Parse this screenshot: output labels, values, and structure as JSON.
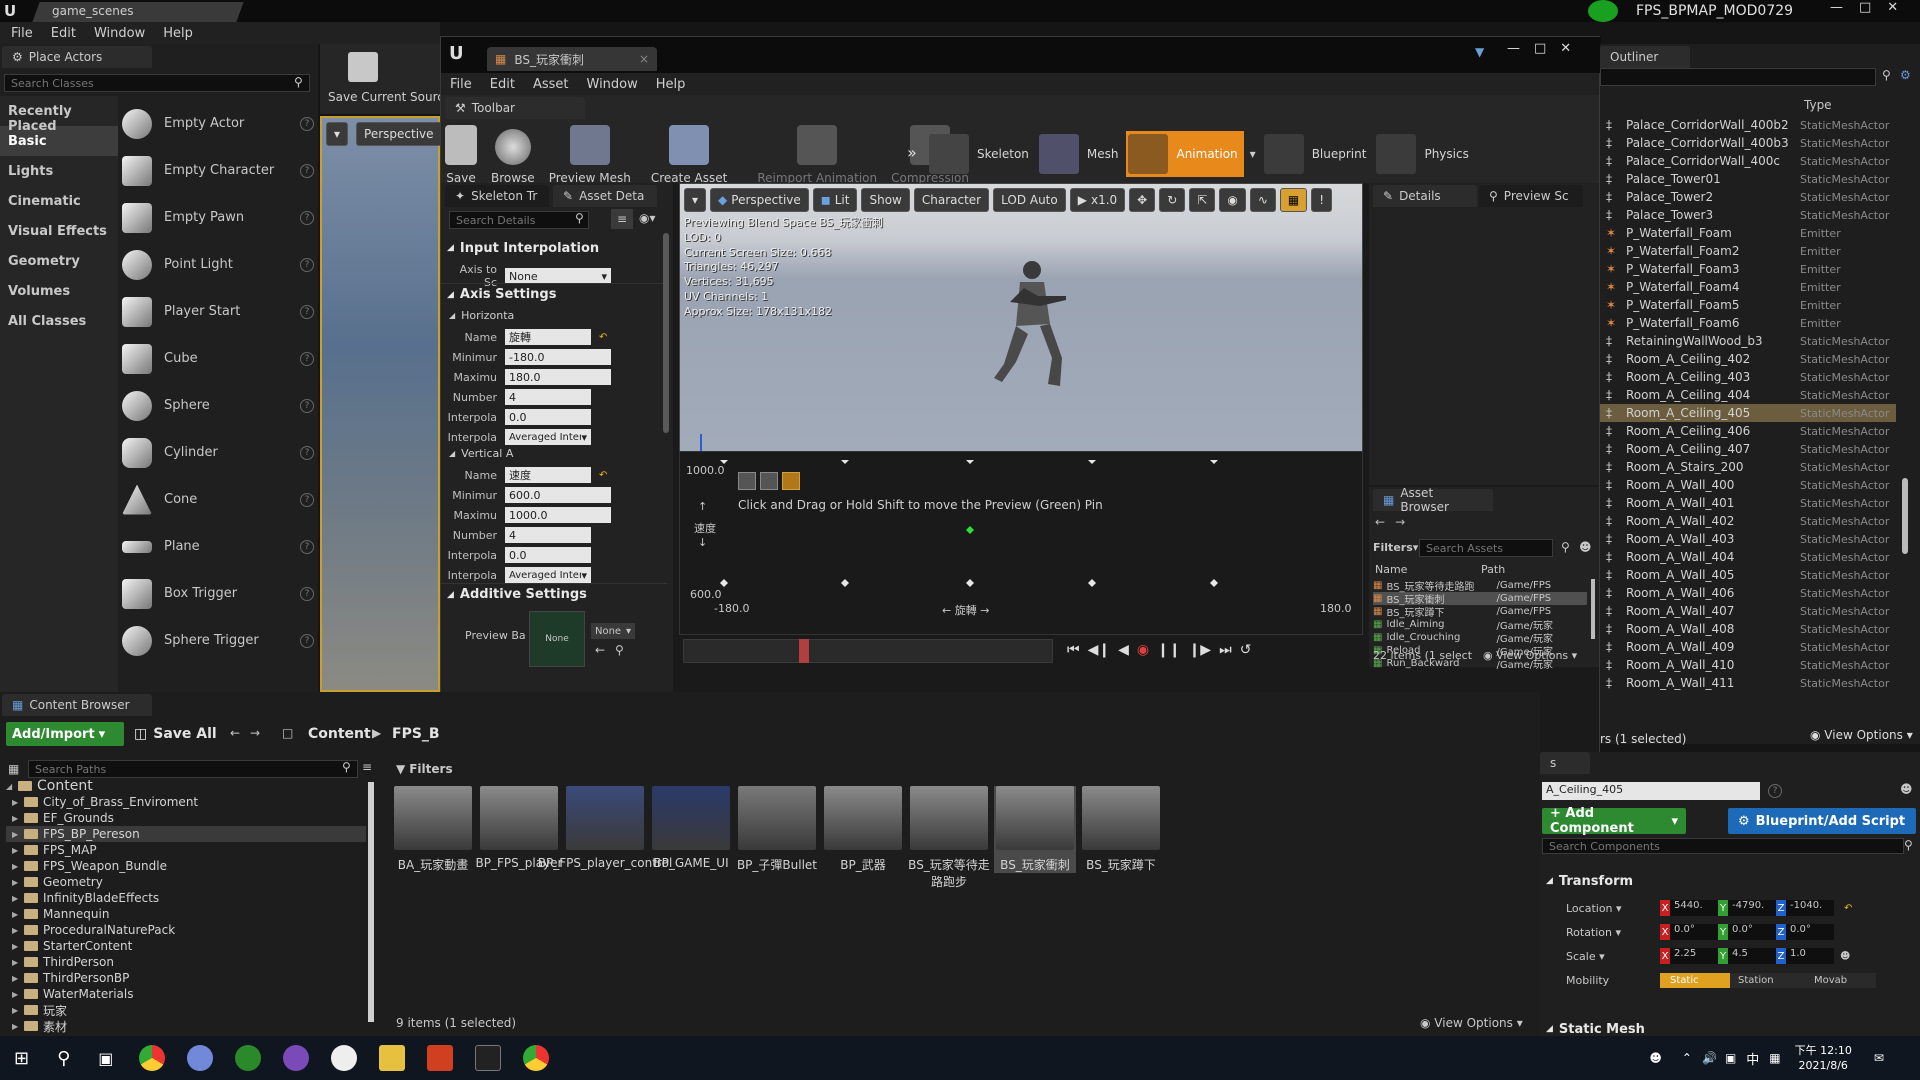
{
  "main_window": {
    "tab": "game_scenes",
    "right_title": "FPS_BPMAP_MOD0729",
    "menu": [
      "File",
      "Edit",
      "Window",
      "Help"
    ]
  },
  "place_actors": {
    "tab": "Place Actors",
    "search_placeholder": "Search Classes",
    "categories": [
      "Recently Placed",
      "Basic",
      "Lights",
      "Cinematic",
      "Visual Effects",
      "Geometry",
      "Volumes",
      "All Classes"
    ],
    "items": [
      "Empty Actor",
      "Empty Character",
      "Empty Pawn",
      "Point Light",
      "Player Start",
      "Cube",
      "Sphere",
      "Cylinder",
      "Cone",
      "Plane",
      "Box Trigger",
      "Sphere Trigger"
    ]
  },
  "main_toolbar": {
    "save_current": "Save Current",
    "source": "Sourc"
  },
  "main_viewport": {
    "perspective": "Perspective"
  },
  "editor": {
    "tab": "BS_玩家衝刺",
    "menu": [
      "File",
      "Edit",
      "Asset",
      "Window",
      "Help"
    ],
    "toolbar_tab": "Toolbar",
    "toolbar": [
      "Save",
      "Browse",
      "Preview Mesh",
      "Create Asset",
      "Reimport Animation",
      "Compression"
    ],
    "modes": [
      "Skeleton",
      "Mesh",
      "Animation",
      "Blueprint",
      "Physics"
    ],
    "left_tabs": [
      "Skeleton Tr",
      "Asset Deta"
    ],
    "search_details": "Search Details",
    "input_interp": {
      "title": "Input Interpolation",
      "axis_label": "Axis to Sc",
      "axis_value": "None"
    },
    "axis_settings": "Axis Settings",
    "horizontal": {
      "title": "Horizonta",
      "name_label": "Name",
      "name": "旋轉",
      "min_label": "Minimur",
      "min": "-180.0",
      "max_label": "Maximu",
      "max": "180.0",
      "num_label": "Number",
      "num": "4",
      "interp_label": "Interpola",
      "interp": "0.0",
      "interp2_label": "Interpola",
      "interp2": "Averaged Interpo"
    },
    "vertical": {
      "title": "Vertical A",
      "name_label": "Name",
      "name": "速度",
      "min_label": "Minimur",
      "min": "600.0",
      "max_label": "Maximu",
      "max": "1000.0",
      "num_label": "Number",
      "num": "4",
      "interp_label": "Interpola",
      "interp": "0.0",
      "interp2_label": "Interpola",
      "interp2": "Averaged Interpo"
    },
    "additive": {
      "title": "Additive Settings",
      "preview_label": "Preview Ba",
      "thumb": "None",
      "select": "None"
    },
    "viewport_buttons": [
      "Perspective",
      "Lit",
      "Show",
      "Character",
      "LOD Auto",
      "x1.0"
    ],
    "preview_info": [
      "Previewing Blend Space BS_玩家衝刺",
      "LOD: 0",
      "Current Screen Size: 0.668",
      "Triangles: 46,297",
      "Vertices: 31,695",
      "UV Channels: 1",
      "Approx Size: 178x131x182"
    ],
    "blend": {
      "y_max": "1000.0",
      "y_min": "600.0",
      "x_min": "-180.0",
      "x_max": "180.0",
      "x_label": "旋轉",
      "y_label": "速度",
      "hint": "Click and Drag or Hold Shift to move the Preview (Green) Pin"
    },
    "right_tabs": [
      "Details",
      "Preview Sc"
    ],
    "asset_browser": {
      "title": "Asset Browser",
      "filters": "Filters",
      "search": "Search Assets",
      "col_name": "Name",
      "col_path": "Path",
      "rows": [
        {
          "name": "BS_玩家等待走路跑",
          "path": "/Game/FPS"
        },
        {
          "name": "BS_玩家衝刺",
          "path": "/Game/FPS"
        },
        {
          "name": "BS_玩家蹲下",
          "path": "/Game/FPS"
        },
        {
          "name": "Idle_Aiming",
          "path": "/Game/玩家"
        },
        {
          "name": "Idle_Crouching",
          "path": "/Game/玩家"
        },
        {
          "name": "Reload",
          "path": "/Game/玩家"
        },
        {
          "name": "Run_Backward",
          "path": "/Game/玩家"
        }
      ],
      "count": "22 items (1 select",
      "view": "View Options"
    }
  },
  "outliner": {
    "tab": "Outliner",
    "type_col": "Type",
    "rows": [
      {
        "n": "Palace_CorridorWall_400b2",
        "t": "StaticMeshActor"
      },
      {
        "n": "Palace_CorridorWall_400b3",
        "t": "StaticMeshActor"
      },
      {
        "n": "Palace_CorridorWall_400c",
        "t": "StaticMeshActor"
      },
      {
        "n": "Palace_Tower01",
        "t": "StaticMeshActor"
      },
      {
        "n": "Palace_Tower2",
        "t": "StaticMeshActor"
      },
      {
        "n": "Palace_Tower3",
        "t": "StaticMeshActor"
      },
      {
        "n": "P_Waterfall_Foam",
        "t": "Emitter"
      },
      {
        "n": "P_Waterfall_Foam2",
        "t": "Emitter"
      },
      {
        "n": "P_Waterfall_Foam3",
        "t": "Emitter"
      },
      {
        "n": "P_Waterfall_Foam4",
        "t": "Emitter"
      },
      {
        "n": "P_Waterfall_Foam5",
        "t": "Emitter"
      },
      {
        "n": "P_Waterfall_Foam6",
        "t": "Emitter"
      },
      {
        "n": "RetainingWallWood_b3",
        "t": "StaticMeshActor"
      },
      {
        "n": "Room_A_Ceiling_402",
        "t": "StaticMeshActor"
      },
      {
        "n": "Room_A_Ceiling_403",
        "t": "StaticMeshActor"
      },
      {
        "n": "Room_A_Ceiling_404",
        "t": "StaticMeshActor"
      },
      {
        "n": "Room_A_Ceiling_405",
        "t": "StaticMeshActor"
      },
      {
        "n": "Room_A_Ceiling_406",
        "t": "StaticMeshActor"
      },
      {
        "n": "Room_A_Ceiling_407",
        "t": "StaticMeshActor"
      },
      {
        "n": "Room_A_Stairs_200",
        "t": "StaticMeshActor"
      },
      {
        "n": "Room_A_Wall_400",
        "t": "StaticMeshActor"
      },
      {
        "n": "Room_A_Wall_401",
        "t": "StaticMeshActor"
      },
      {
        "n": "Room_A_Wall_402",
        "t": "StaticMeshActor"
      },
      {
        "n": "Room_A_Wall_403",
        "t": "StaticMeshActor"
      },
      {
        "n": "Room_A_Wall_404",
        "t": "StaticMeshActor"
      },
      {
        "n": "Room_A_Wall_405",
        "t": "StaticMeshActor"
      },
      {
        "n": "Room_A_Wall_406",
        "t": "StaticMeshActor"
      },
      {
        "n": "Room_A_Wall_407",
        "t": "StaticMeshActor"
      },
      {
        "n": "Room_A_Wall_408",
        "t": "StaticMeshActor"
      },
      {
        "n": "Room_A_Wall_409",
        "t": "StaticMeshActor"
      },
      {
        "n": "Room_A_Wall_410",
        "t": "StaticMeshActor"
      },
      {
        "n": "Room_A_Wall_411",
        "t": "StaticMeshActor"
      }
    ],
    "selected": "Room_A_Ceiling_405",
    "status": "rs (1 selected)",
    "view": "View Options"
  },
  "details": {
    "tab": "s",
    "name": "A_Ceiling_405",
    "add_component": "+ Add Component",
    "blueprint": "Blueprint/Add Script",
    "search": "Search Components",
    "transform": "Transform",
    "location_label": "Location",
    "loc": [
      "5440.",
      "-4790.",
      "-1040."
    ],
    "rotation_label": "Rotation",
    "rot": [
      "0.0°",
      "0.0°",
      "0.0°"
    ],
    "scale_label": "Scale",
    "scale": [
      "2.25",
      "4.5",
      "1.0"
    ],
    "mobility_label": "Mobility",
    "mobility": [
      "Static",
      "Station",
      "Movab"
    ],
    "static_mesh": "Static Mesh"
  },
  "content_browser": {
    "tab": "Content Browser",
    "add_import": "Add/Import",
    "save_all": "Save All",
    "crumbs": [
      "Content",
      "FPS_B"
    ],
    "search_paths": "Search Paths",
    "filters": "Filters",
    "tree": [
      "Content",
      "City_of_Brass_Enviroment",
      "EF_Grounds",
      "FPS_BP_Pereson",
      "FPS_MAP",
      "FPS_Weapon_Bundle",
      "Geometry",
      "InfinityBladeEffects",
      "Mannequin",
      "ProceduralNaturePack",
      "StarterContent",
      "ThirdPerson",
      "ThirdPersonBP",
      "WaterMaterials",
      "玩家",
      "素材"
    ],
    "assets": [
      "BA_玩家動畫",
      "BP_FPS_player",
      "BP_FPS_player_control",
      "BP_GAME_UI",
      "BP_子彈Bullet",
      "BP_武器",
      "BS_玩家等待走路跑步",
      "BS_玩家衝刺",
      "BS_玩家蹲下"
    ],
    "count": "9 items (1 selected)",
    "view": "View Options"
  },
  "taskbar": {
    "time": "下午 12:10",
    "date": "2021/8/6",
    "ime": "中"
  }
}
